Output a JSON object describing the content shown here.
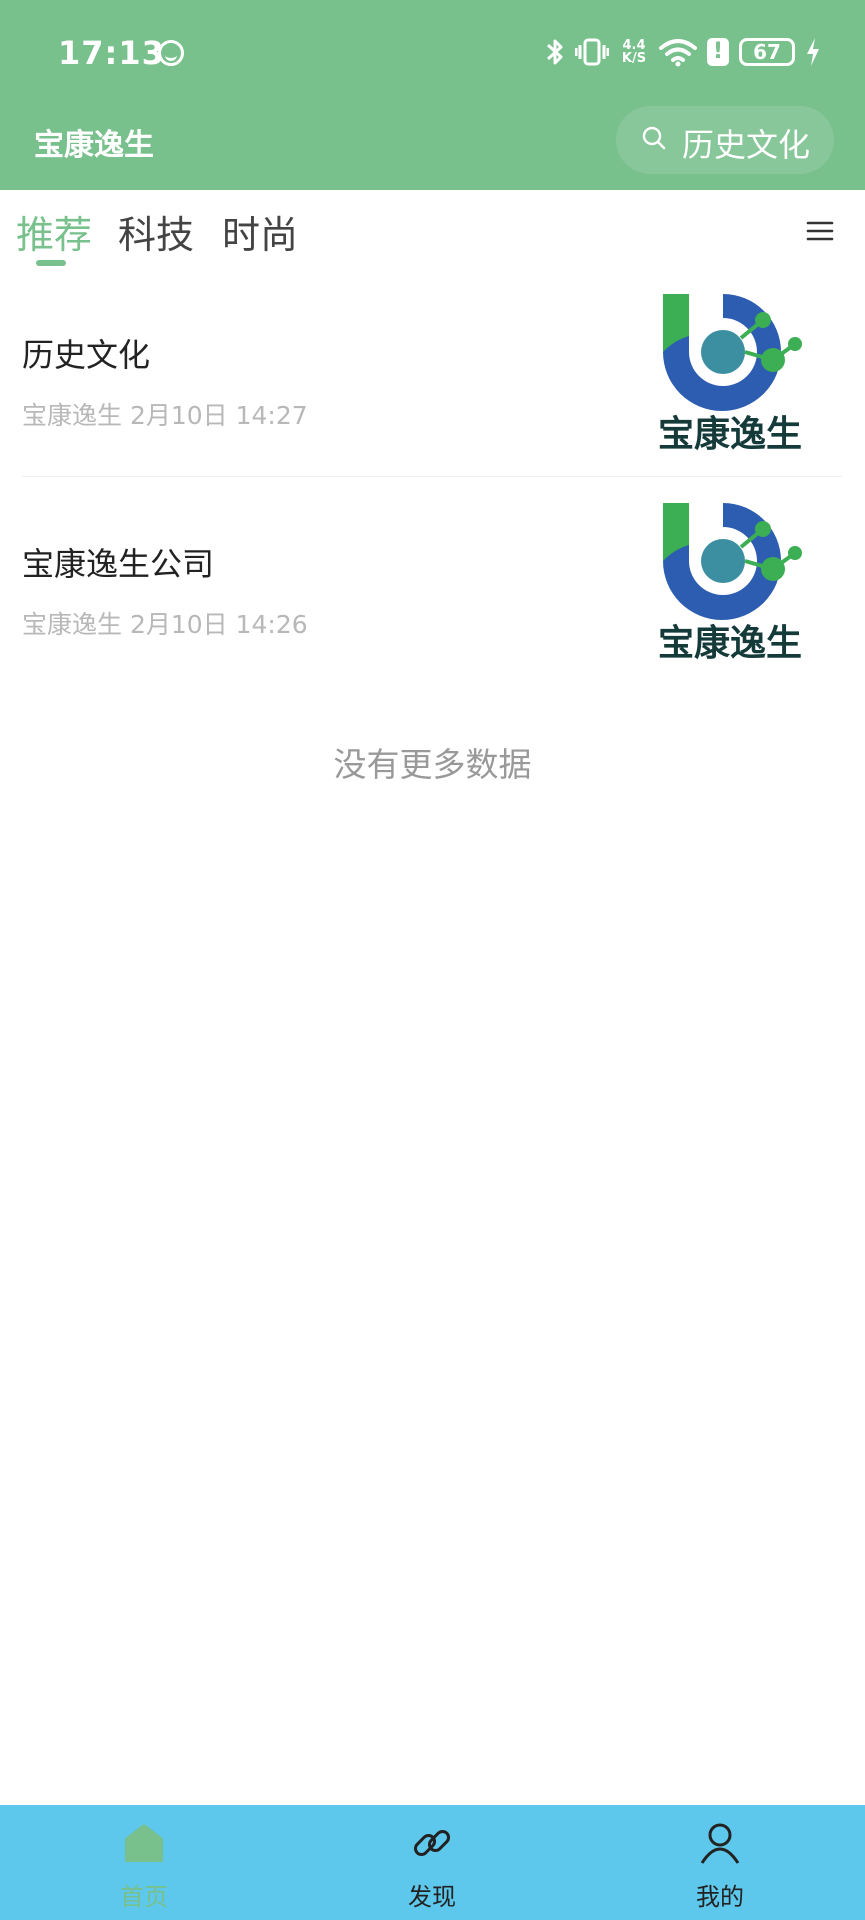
{
  "status_bar": {
    "time": "17:13",
    "net_speed_top": "4.4",
    "net_speed_bottom": "K/S",
    "alert": "!",
    "battery": "67"
  },
  "app_bar": {
    "title": "宝康逸生",
    "search_text": "历史文化"
  },
  "tabs": [
    {
      "label": "推荐",
      "active": true
    },
    {
      "label": "科技",
      "active": false
    },
    {
      "label": "时尚",
      "active": false
    }
  ],
  "articles": [
    {
      "title": "历史文化",
      "meta": "宝康逸生 2月10日 14:27",
      "thumb_text": "宝康逸生"
    },
    {
      "title": "宝康逸生公司",
      "meta": "宝康逸生 2月10日 14:26",
      "thumb_text": "宝康逸生"
    }
  ],
  "list_footer": "没有更多数据",
  "bottom_nav": [
    {
      "label": "首页",
      "icon": "home-icon",
      "active": true
    },
    {
      "label": "发现",
      "icon": "link-icon",
      "active": false
    },
    {
      "label": "我的",
      "icon": "person-icon",
      "active": false
    }
  ],
  "colors": {
    "primary_green": "#78c08c",
    "bottom_bar": "#5ec8ec",
    "logo_green": "#3cae54",
    "logo_blue": "#2c5db0"
  }
}
